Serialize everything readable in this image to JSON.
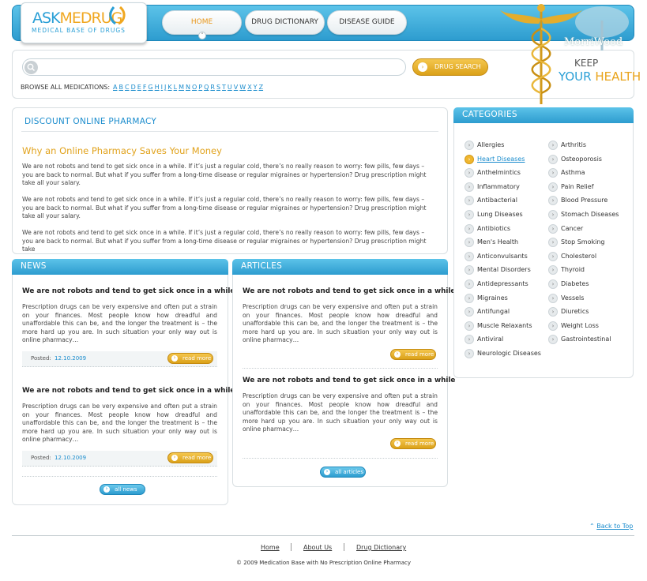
{
  "logo": {
    "brand_a": "ASK",
    "brand_b": "MEDRUG",
    "tagline": "MEDICAL BASE OF DRUGS"
  },
  "nav": {
    "home": "HOME",
    "drug_dictionary": "DRUG DICTIONARY",
    "disease_guide": "DISEASE GUIDE"
  },
  "search": {
    "value": "",
    "placeholder": "",
    "button": "DRUG SEARCH"
  },
  "browse": {
    "label": "BROWSE ALL MEDICATIONS:",
    "letters": [
      "A",
      "B",
      "C",
      "D",
      "E",
      "F",
      "G",
      "H",
      "I",
      "J",
      "K",
      "L",
      "M",
      "N",
      "O",
      "P",
      "Q",
      "R",
      "S",
      "T",
      "U",
      "V",
      "W",
      "X",
      "Y",
      "Z"
    ]
  },
  "banner": {
    "watermark": "MorriWood",
    "keep": "KEEP",
    "your": "YOUR",
    "health": "HEALTH"
  },
  "discount": {
    "title": "DISCOUNT ONLINE PHARMACY",
    "heading": "Why an Online Pharmacy Saves Your Money",
    "paragraphs": [
      "We are not robots and tend to get sick once in a while. If it’s just a regular cold, there’s no really reason to worry: few pills, few days – you are back to normal. But what if you suffer from a long-time disease or regular migraines or hypertension? Drug prescription might take all your salary.",
      "We are not robots and tend to get sick once in a while. If it’s just a regular cold, there’s no really reason to worry: few pills, few days – you are back to normal. But what if you suffer from a long-time disease or regular migraines or hypertension? Drug prescription might take all your salary.",
      "We are not robots and tend to get sick once in a while. If it’s just a regular cold, there’s no really reason to worry: few pills, few days – you are back to normal. But what if you suffer from a long-time disease or regular migraines or hypertension? Drug prescription might take"
    ]
  },
  "news": {
    "title": "NEWS",
    "items": [
      {
        "title": "We are not robots and tend to get sick once in a while",
        "body": "Prescription drugs can be very expensive and often put a strain on your finances. Most people know how dreadful and unaffordable this can be, and the longer the treatment is – the more hard up you are. In such situation your only way out is online pharmacy…",
        "posted_label": "Posted:",
        "date": "12.10.2009",
        "more": "read more"
      },
      {
        "title": "We are not robots and tend to get sick once in a while",
        "body": "Prescription drugs can be very expensive and often put a strain on your finances. Most people know how dreadful and unaffordable this can be, and the longer the treatment is – the more hard up you are. In such situation your only way out is online pharmacy…",
        "posted_label": "Posted:",
        "date": "12.10.2009",
        "more": "read more"
      }
    ],
    "all": "all news"
  },
  "articles": {
    "title": "ARTICLES",
    "items": [
      {
        "title": "We are not robots and tend to get sick once in a while",
        "body": "Prescription drugs can be very expensive and often put a strain on your finances. Most people know how dreadful and unaffordable this can be, and the longer the treatment is – the more hard up you are. In such situation your only way out is online pharmacy…",
        "more": "read more"
      },
      {
        "title": "We are not robots and tend to get sick once in a while",
        "body": "Prescription drugs can be very expensive and often put a strain on your finances. Most people know how dreadful and unaffordable this can be, and the longer the treatment is – the more hard up you are. In such situation your only way out is online pharmacy…",
        "more": "read more"
      }
    ],
    "all": "all articles"
  },
  "categories": {
    "title": "CATEGORIES",
    "left": [
      "Allergies",
      "Heart Diseases",
      "Anthelmintics",
      "Inflammatory",
      "Antibacterial",
      "Lung Diseases",
      "Antibiotics",
      "Men's Health",
      "Anticonvulsants",
      "Mental Disorders",
      "Antidepressants",
      "Migraines",
      "Antifungal",
      "Muscle Relaxants",
      "Antiviral",
      "Neurologic Diseases"
    ],
    "right": [
      "Arthritis",
      "Osteoporosis",
      "Asthma",
      "Pain Relief",
      "Blood Pressure",
      "Stomach Diseases",
      "Cancer",
      "Stop Smoking",
      "Cholesterol",
      "Thyroid",
      "Diabetes",
      "Vessels",
      "Diuretics",
      "Weight Loss",
      "Gastrointestinal"
    ],
    "active": "Heart Diseases"
  },
  "footer": {
    "back_top": "Back to Top",
    "links": [
      "Home",
      "About Us",
      "Drug Dictionary"
    ],
    "copyright": "© 2009 Medication Base with No Prescription Online Pharmacy"
  },
  "colors": {
    "accent_blue": "#2a9fd6",
    "accent_orange": "#e1a21b"
  }
}
